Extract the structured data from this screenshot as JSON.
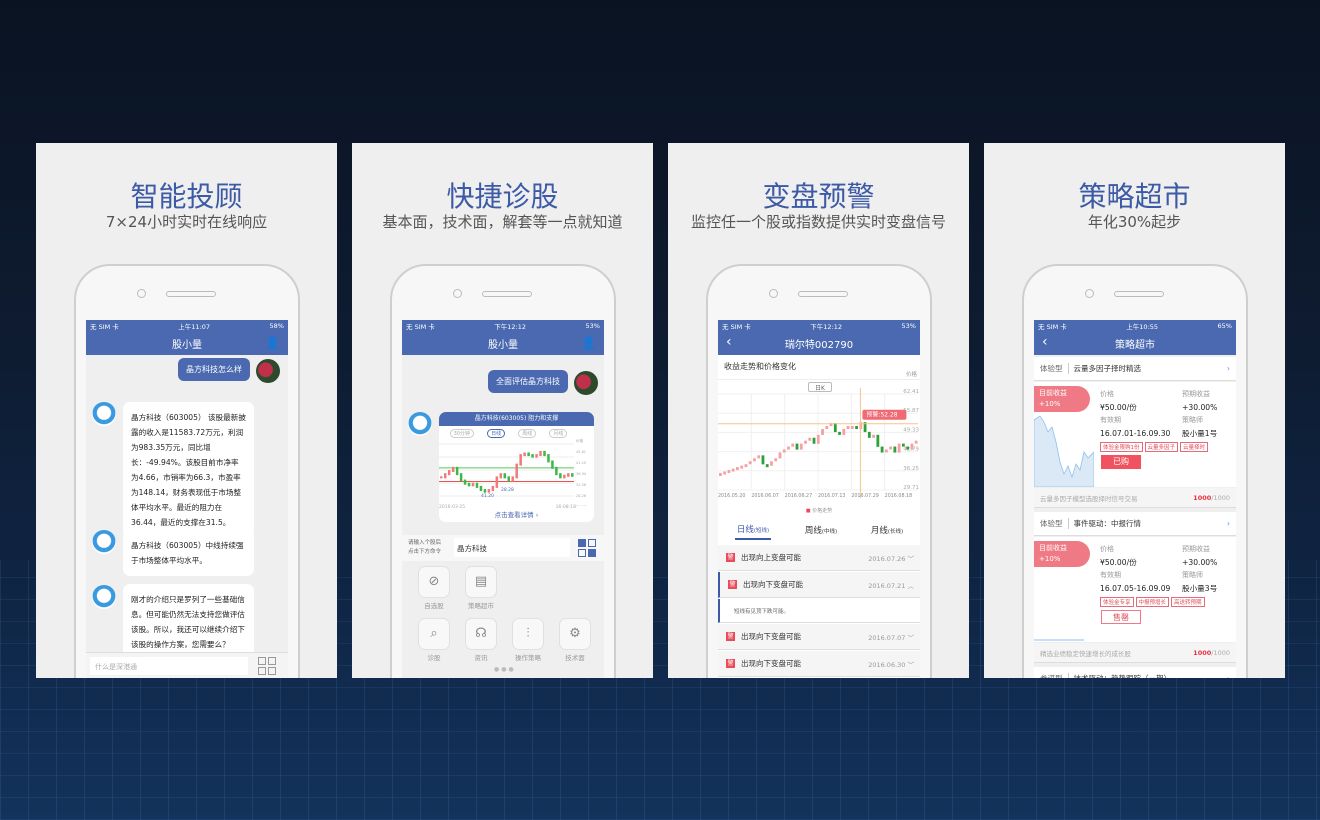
{
  "panels": [
    {
      "title": "智能投顾",
      "subtitle": "7×24小时实时在线响应"
    },
    {
      "title": "快捷诊股",
      "subtitle": "基本面，技术面，解套等一点就知道"
    },
    {
      "title": "变盘预警",
      "subtitle": "监控任一个股或指数提供实时变盘信号"
    },
    {
      "title": "策略超市",
      "subtitle": "年化30%起步"
    }
  ],
  "s1": {
    "carrier": "无 SIM 卡",
    "time": "上午11:07",
    "battery": "58%",
    "title": "股小量",
    "user_msg": "晶方科技怎么样",
    "bot_msgs": [
      "晶方科技（603005） 该股最新披露的收入是11583.72万元，利润为983.35万元，同比增长：-49.94%。该股目前市净率为4.66，市销率为66.3，市盈率为148.14，财务表现低于市场整体平均水平。最近的阻力在36.44，最近的支撑在31.5。",
      "晶方科技（603005）中线持续强于市场整体平均水平。",
      "刚才的介绍只是罗列了一些基础信息。但可能仍然无法支持您做评估该股。所以，我还可以继续介绍下该股的操作方案，您需要么？"
    ],
    "input_placeholder": "什么是深港通"
  },
  "s2": {
    "carrier": "无 SIM 卡",
    "time": "下午12:12",
    "battery": "53%",
    "title": "股小量",
    "user_msg": "全面评估晶方科技",
    "card_title": "晶方科技(603005) 阻力和支撑",
    "tabs": [
      "30分钟",
      "日线",
      "周线",
      "月线"
    ],
    "axis": [
      "价格",
      "45.61",
      "41.20",
      "36.94",
      "32.58",
      "28.26",
      "23.87"
    ],
    "resistance": "41.20",
    "support": "28.28",
    "date_start": "2016-03-25",
    "date_end": "16-08-18",
    "detail_link": "点击查看详情 ›",
    "prompt": "请输入个股后\n点击下方命令",
    "input_value": "晶方科技",
    "actions": [
      "自选股",
      "策略超市",
      "诊股",
      "资讯",
      "操作策略",
      "技术面"
    ],
    "closes": [
      33,
      34,
      35,
      36,
      34,
      32,
      31,
      30.5,
      31,
      30,
      29,
      28.5,
      29,
      30,
      33,
      34,
      33,
      32,
      33,
      37,
      40,
      40.5,
      40,
      39.5,
      40,
      41,
      40,
      38,
      36,
      34,
      33,
      33.5,
      34,
      33.5
    ]
  },
  "s3": {
    "carrier": "无 SIM 卡",
    "time": "下午12:12",
    "battery": "53%",
    "title": "瑞尔特002790",
    "section": "收益走势和价格变化",
    "price_label": "价格",
    "kline_btn": "日K",
    "yticks": [
      "62.41",
      "55.87",
      "49.33",
      "42.79",
      "36.25",
      "29.71"
    ],
    "xticks": [
      "2016.05.20",
      "2016.06.07",
      "2016.06.27",
      "2016.07.13",
      "2016.07.29",
      "2016.08.18"
    ],
    "alert": "预警:52.28",
    "legend": "价格走势",
    "closes": [
      35,
      35.5,
      36,
      36.5,
      37,
      37.5,
      38,
      39,
      40,
      41,
      38,
      37.5,
      39,
      40,
      42,
      43,
      44,
      45,
      43,
      45,
      46,
      47,
      45,
      48,
      50,
      51,
      52,
      49,
      48,
      50,
      51,
      51,
      50,
      52.3,
      49,
      47,
      48,
      44,
      42,
      43,
      44,
      42,
      45,
      44,
      43,
      45,
      46
    ],
    "tabs": [
      {
        "label": "日线",
        "sub": "(短线)"
      },
      {
        "label": "周线",
        "sub": "(中线)"
      },
      {
        "label": "月线",
        "sub": "(长线)"
      }
    ],
    "alerts": [
      {
        "icon": "警",
        "text": "出现向上变盘可能",
        "date": "2016.07.26",
        "open": false
      },
      {
        "icon": "警",
        "text": "出现向下变盘可能",
        "date": "2016.07.21",
        "open": true,
        "detail": "短线有见顶下跌可能。"
      },
      {
        "icon": "警",
        "text": "出现向下变盘可能",
        "date": "2016.07.07",
        "open": false
      },
      {
        "icon": "警",
        "text": "出现向下变盘可能",
        "date": "2016.06.30",
        "open": false
      }
    ]
  },
  "s4": {
    "carrier": "无 SIM 卡",
    "time": "上午10:55",
    "battery": "65%",
    "title": "策略超市",
    "labels": {
      "gain": "目前收益",
      "price": "价格",
      "expected": "预期收益",
      "valid": "有效期",
      "strategist": "策略师"
    },
    "items": [
      {
        "type": "体验型",
        "name": "云量多因子择时精选",
        "gain": "+10%",
        "price": "¥50.00/份",
        "expected": "+30.00%",
        "valid": "16.07.01-16.09.30",
        "strategist": "股小量1号",
        "tags": [
          "体验金限购1份",
          "云量多因子",
          "云量择时"
        ],
        "button": "已购",
        "desc": "云量多因子模型选股择时信号交易",
        "sold": "1000",
        "total": "/1000"
      },
      {
        "type": "体验型",
        "name": "事件驱动：中报行情",
        "gain": "+10%",
        "price": "¥50.00/份",
        "expected": "+30.00%",
        "valid": "16.07.05-16.09.09",
        "strategist": "股小量3号",
        "tags": [
          "体验金专享",
          "中报预增长",
          "高送转预期"
        ],
        "button": "售罄",
        "desc": "精选业绩稳定快速增长的成长股",
        "sold": "1000",
        "total": "/1000"
      },
      {
        "type": "参谋型",
        "name": "技术驱动：趋势跟踪（一期）"
      }
    ]
  }
}
